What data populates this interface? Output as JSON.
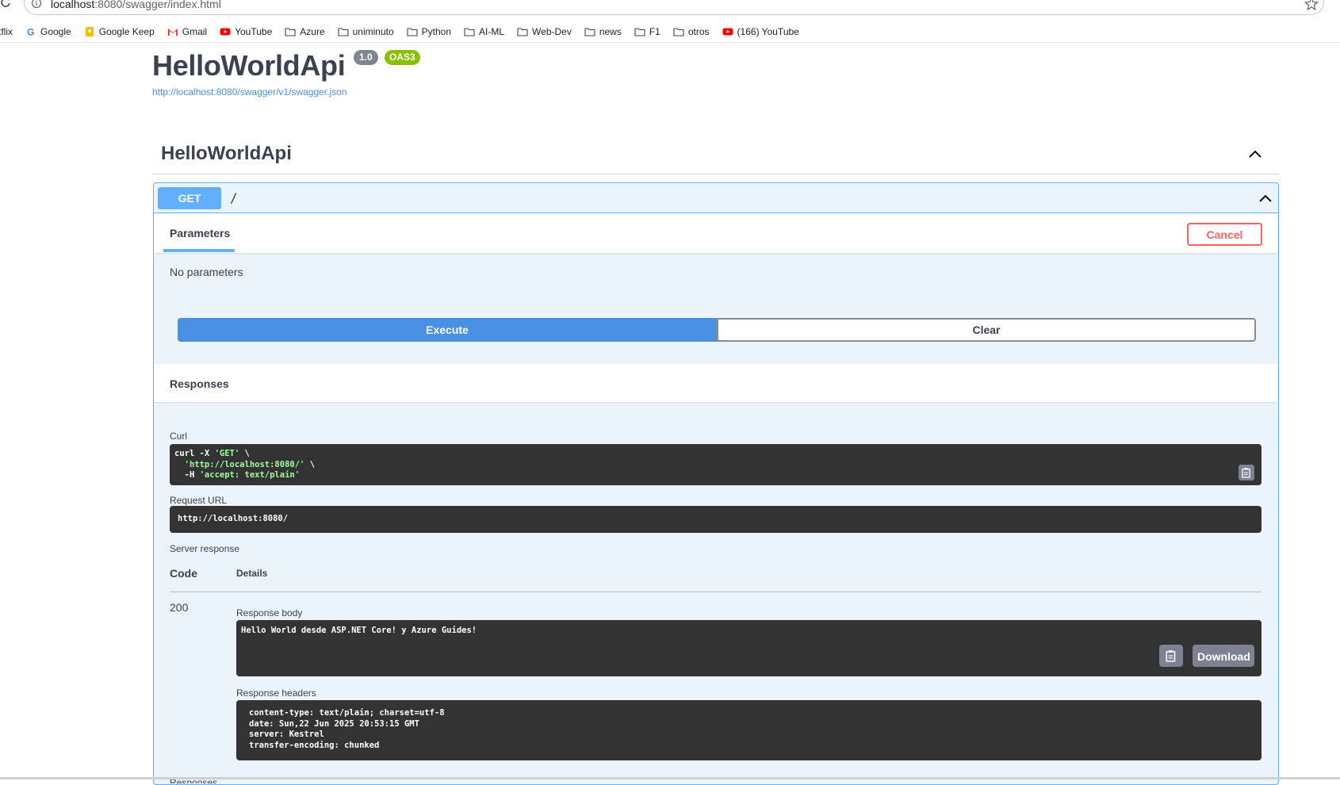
{
  "browser": {
    "url_host": "localhost",
    "url_path": ":8080/swagger/index.html",
    "bookmarks": [
      {
        "label": "tflix",
        "icon": "none"
      },
      {
        "label": "Google",
        "icon": "google-icon"
      },
      {
        "label": "Google Keep",
        "icon": "keep-icon"
      },
      {
        "label": "Gmail",
        "icon": "gmail-icon"
      },
      {
        "label": "YouTube",
        "icon": "youtube-icon"
      },
      {
        "label": "Azure",
        "icon": "folder-icon"
      },
      {
        "label": "uniminuto",
        "icon": "folder-icon"
      },
      {
        "label": "Python",
        "icon": "folder-icon"
      },
      {
        "label": "AI-ML",
        "icon": "folder-icon"
      },
      {
        "label": "Web-Dev",
        "icon": "folder-icon"
      },
      {
        "label": "news",
        "icon": "folder-icon"
      },
      {
        "label": "F1",
        "icon": "folder-icon"
      },
      {
        "label": "otros",
        "icon": "folder-icon"
      },
      {
        "label": "(166) YouTube",
        "icon": "youtube-icon"
      }
    ]
  },
  "info": {
    "title": "HelloWorldApi",
    "version": "1.0",
    "oas": "OAS3",
    "spec_url": "http://localhost:8080/swagger/v1/swagger.json"
  },
  "tag": {
    "name": "HelloWorldApi"
  },
  "operation": {
    "method": "GET",
    "path": "/",
    "parameters_tab": "Parameters",
    "cancel_label": "Cancel",
    "no_params": "No parameters",
    "execute_label": "Execute",
    "clear_label": "Clear",
    "responses_title": "Responses",
    "curl_label": "Curl",
    "curl_line1_cmd": "curl -X ",
    "curl_line1_str": "'GET'",
    "curl_line1_end": " \\",
    "curl_line2_str": "  'http://localhost:8080/'",
    "curl_line2_end": " \\",
    "curl_line3_cmd": "  -H ",
    "curl_line3_str": "'accept: text/plain'",
    "request_url_label": "Request URL",
    "request_url": "http://localhost:8080/",
    "server_response_label": "Server response",
    "code_header": "Code",
    "details_header": "Details",
    "status_code": "200",
    "response_body_label": "Response body",
    "response_body": "Hello World desde ASP.NET Core! y Azure Guides!",
    "download_label": "Download",
    "response_headers_label": "Response headers",
    "response_headers": [
      "content-type: text/plain; charset=utf-8",
      "date: Sun,22 Jun 2025 20:53:15 GMT",
      "server: Kestrel",
      "transfer-encoding: chunked"
    ],
    "cut_label": "Responses"
  }
}
